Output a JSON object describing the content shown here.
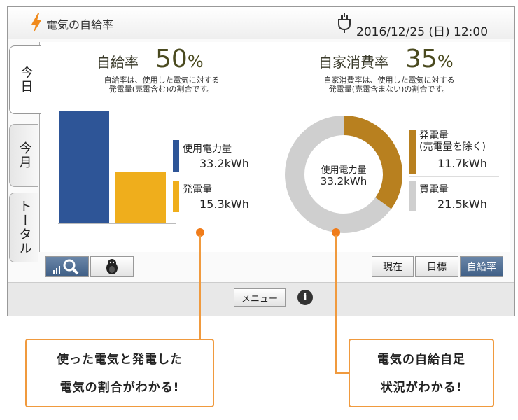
{
  "header": {
    "app_title": "電気の自給率",
    "datetime": "2016/12/25 (日) 12:00"
  },
  "tabs": [
    {
      "label": "今日",
      "active": true
    },
    {
      "label": "今月",
      "active": false
    },
    {
      "label": "トータル",
      "active": false
    }
  ],
  "self_sufficiency": {
    "label": "自給率",
    "value": "50",
    "unit": "%",
    "description_line1": "自給率は、使用した電気に対する",
    "description_line2": "発電量(売電含む)の割合です。",
    "bar_usage": 33.2,
    "bar_generation": 15.3,
    "usage_label": "使用電力量",
    "usage_value": "33.2kWh",
    "generation_label": "発電量",
    "generation_value": "15.3kWh"
  },
  "self_consumption": {
    "label": "自家消費率",
    "value": "35",
    "unit": "%",
    "description_line1": "自家消費率は、使用した電気に対する",
    "description_line2": "発電量(売電含まない)の割合です。",
    "donut_fraction": 0.35,
    "center_label": "使用電力量",
    "center_value": "33.2kWh",
    "generation_label_line1": "発電量",
    "generation_label_line2": "(売電量を除く)",
    "generation_value": "11.7kWh",
    "purchased_label": "買電量",
    "purchased_value": "21.5kWh"
  },
  "view_buttons": {
    "current": "現在",
    "target": "目標",
    "self_rate": "自給率"
  },
  "bottom": {
    "menu_label": "メニュー"
  },
  "callouts": {
    "left_line1": "使った電気と発電した",
    "left_line2": "電気の割合がわかる!",
    "right_line1": "電気の自給自足",
    "right_line2": "状況がわかる!"
  },
  "colors": {
    "usage_blue": "#2e5597",
    "generation_yellow": "#efae1c",
    "donut_gold": "#b8801f",
    "donut_gray": "#cfcfcf",
    "accent_orange": "#f07c1a"
  }
}
